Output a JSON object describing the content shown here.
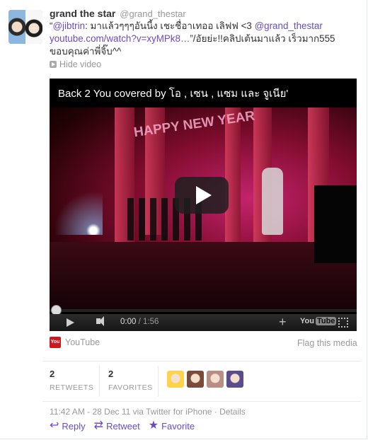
{
  "user": {
    "name": "grand the star",
    "handle": "@grand_thestar"
  },
  "tweet": {
    "quote_open": "“",
    "mention1": "@jibtrin",
    "text1": ": มาแล้วๆๆๆอันนี้ง เชะชื่อาเทออ เลิฟฟ <3 ",
    "mention2": "@grand_thestar",
    "link": "youtube.com/watch?v=xyMPk8…",
    "text2": "”/อัยย่ะ!!คลิปเต้นมาแล้ว เร็วมาก555 ขอบคุณค่าพี่จิ๊บ^^"
  },
  "media": {
    "hide_label": "Hide video",
    "video_title": "Back 2 You covered by โอ , เซน , แซม และ จูเนีย'",
    "sign_text": "HAPPY NEW YEAR",
    "time_current": "0:00",
    "time_separator": " / ",
    "time_duration": "1:56",
    "progress": 0,
    "plus_label": "+",
    "yt_left": "You",
    "yt_right": "Tube",
    "source_label": "YouTube",
    "badge_text": "You Tube",
    "flag_label": "Flag this media"
  },
  "stats": {
    "retweets_count": "2",
    "retweets_label": "RETWEETS",
    "favorites_count": "2",
    "favorites_label": "FAVORITES",
    "face_colors": [
      "#ffd34d",
      "#7a4a3a",
      "#b88f86",
      "#5b4d8c"
    ]
  },
  "meta": {
    "timestamp": "11:42 AM - 28 Dec 11 via Twitter for iPhone · Details"
  },
  "actions": {
    "reply": "Reply",
    "retweet": "Retweet",
    "favorite": "Favorite"
  },
  "colors": {
    "link": "#6a4bc4",
    "muted": "#999999"
  }
}
